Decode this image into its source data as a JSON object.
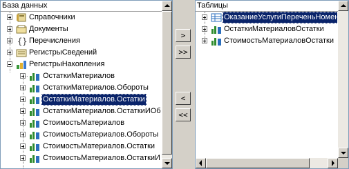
{
  "left": {
    "header": "База данных",
    "items": [
      {
        "label": "Справочники",
        "icon": "catalogs-icon"
      },
      {
        "label": "Документы",
        "icon": "documents-icon"
      },
      {
        "label": "Перечисления",
        "icon": "enumerations-icon"
      },
      {
        "label": "РегистрыСведений",
        "icon": "info-registers-icon"
      },
      {
        "label": "РегистрыНакопления",
        "icon": "accumulation-registers-icon"
      },
      {
        "label": "ОстаткиМатериалов",
        "icon": "table-icon"
      },
      {
        "label": "ОстаткиМатериалов.Обороты",
        "icon": "table-icon"
      },
      {
        "label": "ОстаткиМатериалов.Остатки",
        "icon": "table-icon"
      },
      {
        "label": "ОстаткиМатериалов.ОстаткиИОб",
        "icon": "table-icon"
      },
      {
        "label": "СтоимостьМатериалов",
        "icon": "table-icon"
      },
      {
        "label": "СтоимостьМатериалов.Обороты",
        "icon": "table-icon"
      },
      {
        "label": "СтоимостьМатериалов.Остатки",
        "icon": "table-icon"
      },
      {
        "label": "СтоимостьМатериалов.ОстаткиИ",
        "icon": "table-icon"
      }
    ]
  },
  "right": {
    "header": "Таблицы",
    "items": [
      {
        "label": "ОказаниеУслугиПереченьНоменк",
        "icon": "tabular-section-icon"
      },
      {
        "label": "ОстаткиМатериаловОстатки",
        "icon": "table-icon"
      },
      {
        "label": "СтоимостьМатериаловОстатки",
        "icon": "table-icon"
      }
    ]
  },
  "buttons": {
    "add": ">",
    "add_all": ">>",
    "remove": "<",
    "remove_all": "<<"
  }
}
